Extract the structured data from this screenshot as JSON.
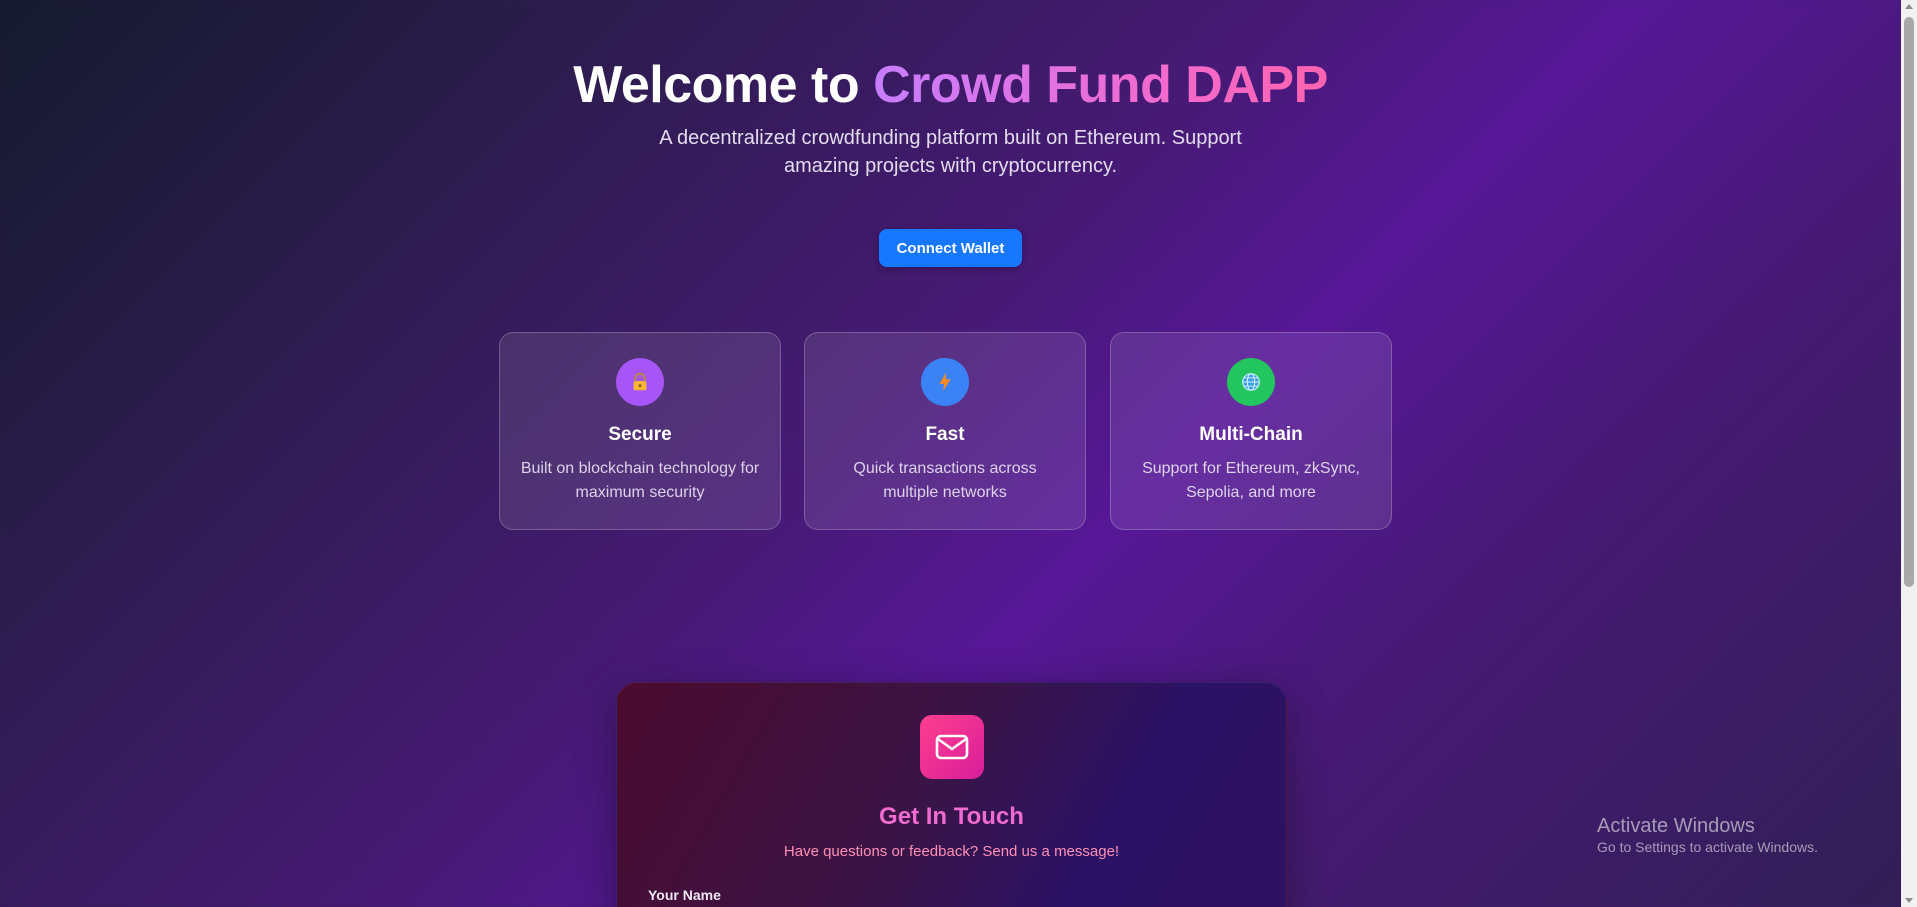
{
  "hero": {
    "title_prefix": "Welcome to ",
    "title_accent": "Crowd Fund DAPP",
    "subtitle": "A decentralized crowdfunding platform built on Ethereum. Support amazing projects with cryptocurrency.",
    "connect_button_label": "Connect Wallet"
  },
  "features": [
    {
      "icon": "lock-icon",
      "icon_color": "#a855f7",
      "title": "Secure",
      "description": "Built on blockchain technology for maximum security"
    },
    {
      "icon": "lightning-icon",
      "icon_color": "#3b82f6",
      "title": "Fast",
      "description": "Quick transactions across multiple networks"
    },
    {
      "icon": "globe-icon",
      "icon_color": "#22c55e",
      "title": "Multi-Chain",
      "description": "Support for Ethereum, zkSync, Sepolia, and more"
    }
  ],
  "contact": {
    "icon": "mail-icon",
    "title": "Get In Touch",
    "subtitle": "Have questions or feedback? Send us a message!",
    "name_label": "Your Name"
  },
  "os_overlay": {
    "title": "Activate Windows",
    "subtitle": "Go to Settings to activate Windows."
  },
  "colors": {
    "primary_button": "#1677ff",
    "accent_gradient_start": "#c77dff",
    "accent_gradient_end": "#ff63b0",
    "contact_title": "#f06bd0",
    "contact_subtitle": "#ff8fb5"
  }
}
